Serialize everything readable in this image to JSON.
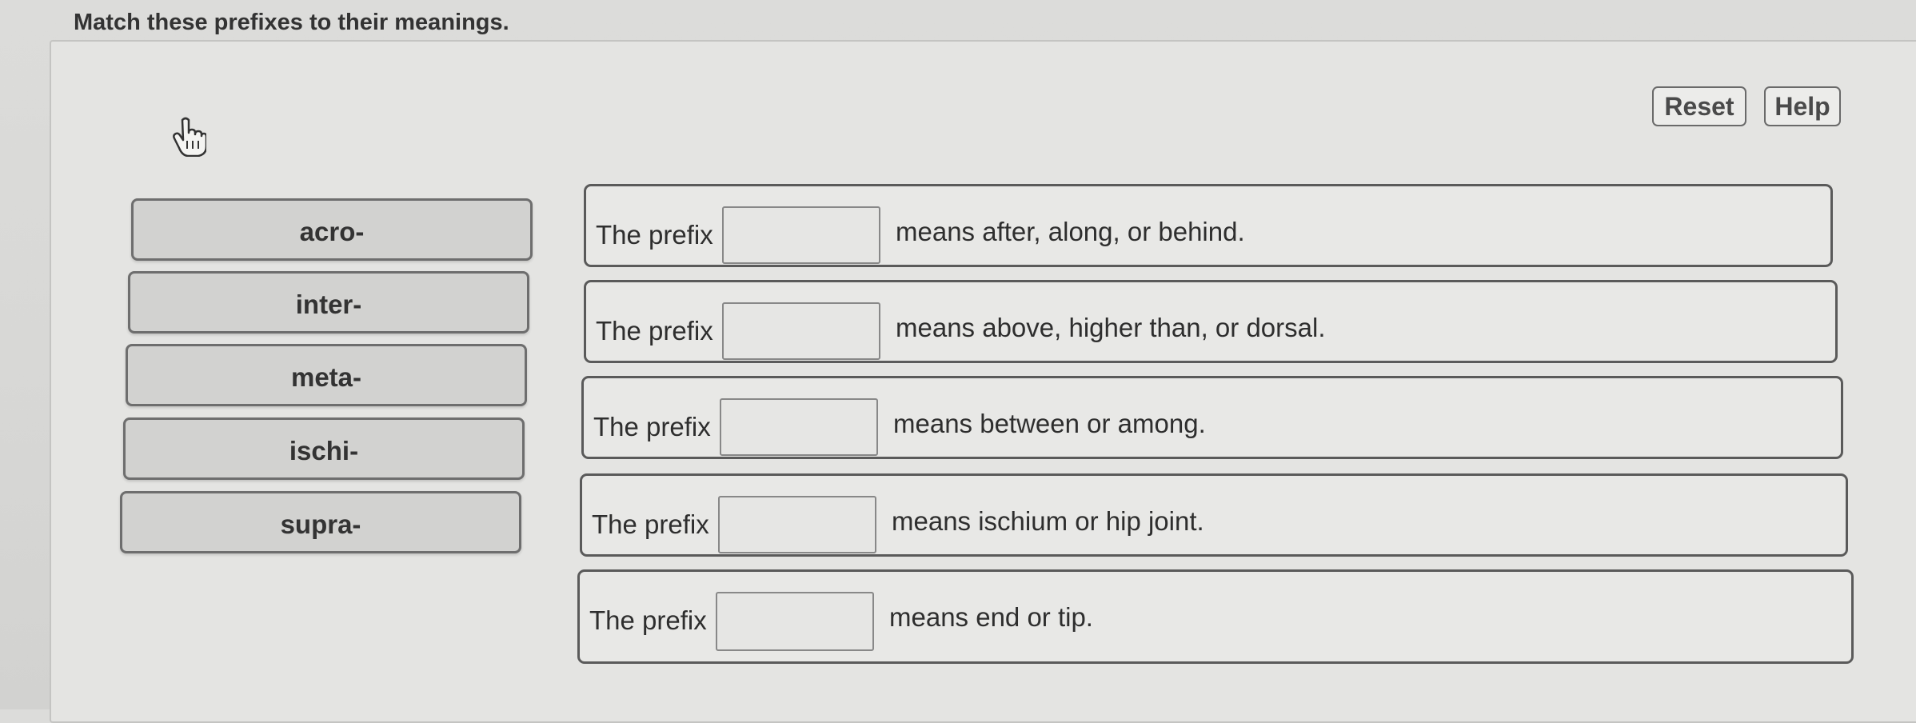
{
  "question": "Match these prefixes to their meanings.",
  "buttons": {
    "reset": "Reset",
    "help": "Help"
  },
  "prefixes": [
    "acro-",
    "inter-",
    "meta-",
    "ischi-",
    "supra-"
  ],
  "rows": [
    {
      "lead": "The prefix",
      "meaning": "means after, along, or behind."
    },
    {
      "lead": "The prefix",
      "meaning": "means above, higher than, or dorsal."
    },
    {
      "lead": "The prefix",
      "meaning": "means between or among."
    },
    {
      "lead": "The prefix",
      "meaning": "means ischium or hip joint."
    },
    {
      "lead": "The prefix",
      "meaning": "means end or tip."
    }
  ],
  "icons": {
    "cursor": "hand-pointer-icon"
  }
}
